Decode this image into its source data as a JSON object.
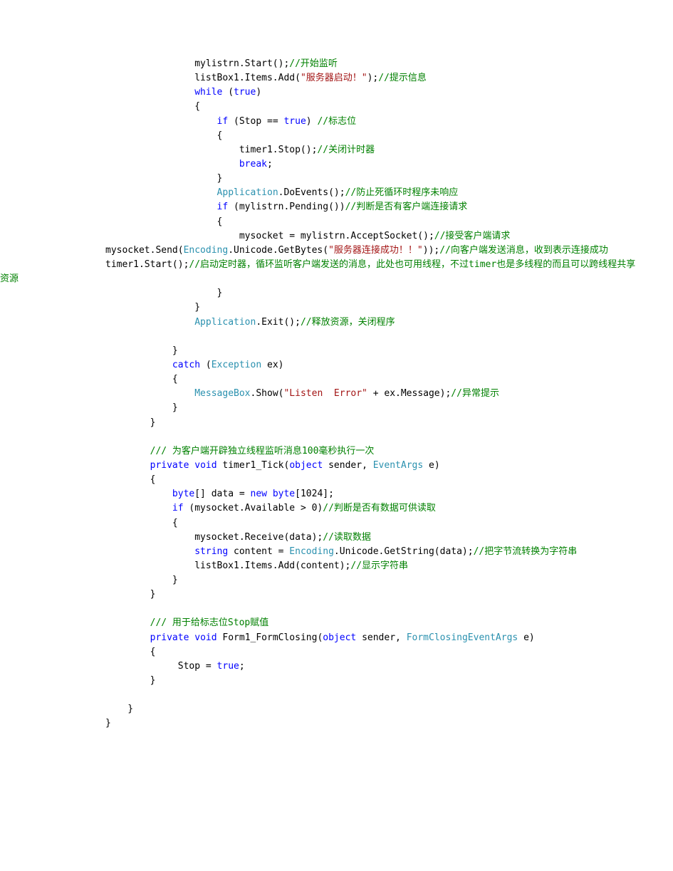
{
  "code": {
    "l01a": "                mylistrn.Start();",
    "l01c": "//开始监听",
    "l02a": "                listBox1.Items.Add(",
    "l02s": "\"服务器启动！\"",
    "l02b": ");",
    "l02c": "//提示信息",
    "l03a": "                ",
    "l03k": "while",
    "l03b": " (",
    "l03k2": "true",
    "l03c": ")",
    "l04a": "                {",
    "l05a": "                    ",
    "l05k": "if",
    "l05b": " (Stop == ",
    "l05k2": "true",
    "l05c": ") ",
    "l05cm": "//标志位",
    "l06a": "                    {",
    "l07a": "                        timer1.Stop();",
    "l07c": "//关闭计时器",
    "l08a": "                        ",
    "l08k": "break",
    "l08b": ";",
    "l09a": "                    }",
    "l10a": "                    ",
    "l10t": "Application",
    "l10b": ".DoEvents();",
    "l10c": "//防止死循环时程序未响应",
    "l11a": "                    ",
    "l11k": "if",
    "l11b": " (mylistrn.Pending())",
    "l11c": "//判断是否有客户端连接请求",
    "l12a": "                    {",
    "l13a": "                        mysocket = mylistrn.AcceptSocket();",
    "l13c": "//接受客户端请求",
    "l14a": "                        mysocket.Send(",
    "l14t": "Encoding",
    "l14b": ".Unicode.GetBytes(",
    "l14s": "\"服务器连接成功！！\"",
    "l14c": "));",
    "l14cm": "//向客户端发送消息，收到表示连接成功",
    "l15a": "                        timer1.Start();",
    "l15c": "//启动定时器，循环监听客户端发送的消息，此处也可用线程，不过timer也是多线程的而且可以跨线程共享资源",
    "l16a": "                    }",
    "l17a": "                }",
    "l18a": "                ",
    "l18t": "Application",
    "l18b": ".Exit();",
    "l18c": "//释放资源，关闭程序",
    "l19a": "",
    "l20a": "            }",
    "l21a": "            ",
    "l21k": "catch",
    "l21b": " (",
    "l21t": "Exception",
    "l21c": " ex)",
    "l22a": "            {",
    "l23a": "                ",
    "l23t": "MessageBox",
    "l23b": ".Show(",
    "l23s": "\"Listen  Error\"",
    "l23c": " + ex.Message);",
    "l23cm": "//异常提示",
    "l24a": "            }",
    "l25a": "        }",
    "l26a": "",
    "l27a": "        ",
    "l27c": "/// 为客户端开辟独立线程监听消息100毫秒执行一次",
    "l28a": "        ",
    "l28k1": "private",
    "l28k2": " void",
    "l28b": " timer1_Tick(",
    "l28k3": "object",
    "l28c": " sender, ",
    "l28t": "EventArgs",
    "l28d": " e)",
    "l29a": "        {",
    "l30a": "            ",
    "l30k": "byte",
    "l30b": "[] data = ",
    "l30k2": "new",
    "l30c": " ",
    "l30k3": "byte",
    "l30d": "[1024];",
    "l31a": "            ",
    "l31k": "if",
    "l31b": " (mysocket.Available > 0)",
    "l31c": "//判断是否有数据可供读取",
    "l32a": "            {",
    "l33a": "                mysocket.Receive(data);",
    "l33c": "//读取数据",
    "l34a": "                ",
    "l34k": "string",
    "l34b": " content = ",
    "l34t": "Encoding",
    "l34c": ".Unicode.GetString(data);",
    "l34cm": "//把字节流转换为字符串",
    "l35a": "                listBox1.Items.Add(content);",
    "l35c": "//显示字符串",
    "l36a": "            }",
    "l37a": "        }",
    "l38a": "",
    "l39a": "        ",
    "l39c": "/// 用于给标志位Stop赋值",
    "l40a": "        ",
    "l40k1": "private",
    "l40k2": " void",
    "l40b": " Form1_FormClosing(",
    "l40k3": "object",
    "l40c": " sender, ",
    "l40t": "FormClosingEventArgs",
    "l40d": " e)",
    "l41a": "        {",
    "l42a": "             Stop = ",
    "l42k": "true",
    "l42b": ";",
    "l43a": "        }",
    "l44a": "",
    "l45a": "    }",
    "l46a": "}"
  }
}
